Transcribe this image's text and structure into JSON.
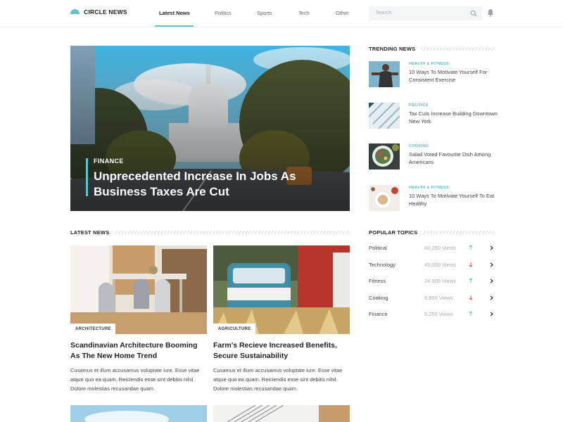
{
  "brand": {
    "name": "CIRCLE NEWS",
    "accent": "#5cc6cf"
  },
  "nav": {
    "items": [
      {
        "label": "Latest News",
        "active": true
      },
      {
        "label": "Politics"
      },
      {
        "label": "Sports"
      },
      {
        "label": "Tech"
      },
      {
        "label": "Other"
      }
    ]
  },
  "search": {
    "placeholder": "Search",
    "icon": "search-icon"
  },
  "notifications": {
    "icon": "bell-icon"
  },
  "hero": {
    "category": "FINANCE",
    "title": "Unprecedented Increase In Jobs As Business Taxes Are Cut"
  },
  "latest": {
    "heading": "LATEST NEWS",
    "cards": [
      {
        "tag": "ARCHITECTURE",
        "title": "Scandinavian Architecture Booming As The New Home Trend",
        "body": "Cusamus et illum accusamus voluptate iure. Esse vitae atque quo ea quam. Reiciendis esse sint debitis nihil. Dolore molestias recusandae quam."
      },
      {
        "tag": "AGRICULTURE",
        "title": "Farm’s Recieve Increased Benefits, Secure Sustainability",
        "body": "Cusamus et illum accusamus voluptate iure. Esse vitae atque quo ea quam. Reiciendis esse sint debitis nihil. Dolore molestias recusandae quam."
      }
    ]
  },
  "trending": {
    "heading": "TRENDING NEWS",
    "items": [
      {
        "category": "HEALTH & FITNESS",
        "title": "10 Ways To Motivate Yourself For Consistent Exercise"
      },
      {
        "category": "POLITICS",
        "title": "Tax Cuts Increase Building Downtown New York"
      },
      {
        "category": "COOKING",
        "title": "Salad Voted Favourite Dish Among Americans"
      },
      {
        "category": "HEALTH & FITNESS",
        "title": "10 Ways To Motivate Yourself To Eat Healthy"
      }
    ]
  },
  "popular": {
    "heading": "POPULAR TOPICS",
    "topics": [
      {
        "name": "Political",
        "views": "60,250 Views",
        "trend": "up"
      },
      {
        "name": "Technology",
        "views": "45,000 Views",
        "trend": "down"
      },
      {
        "name": "Fitness",
        "views": "24,500 Views",
        "trend": "up"
      },
      {
        "name": "Cooking",
        "views": "9,850 Views",
        "trend": "down"
      },
      {
        "name": "Finance",
        "views": "5,250 Views",
        "trend": "up"
      }
    ],
    "colors": {
      "up": "#5cc6cf",
      "down": "#e2553a"
    }
  }
}
